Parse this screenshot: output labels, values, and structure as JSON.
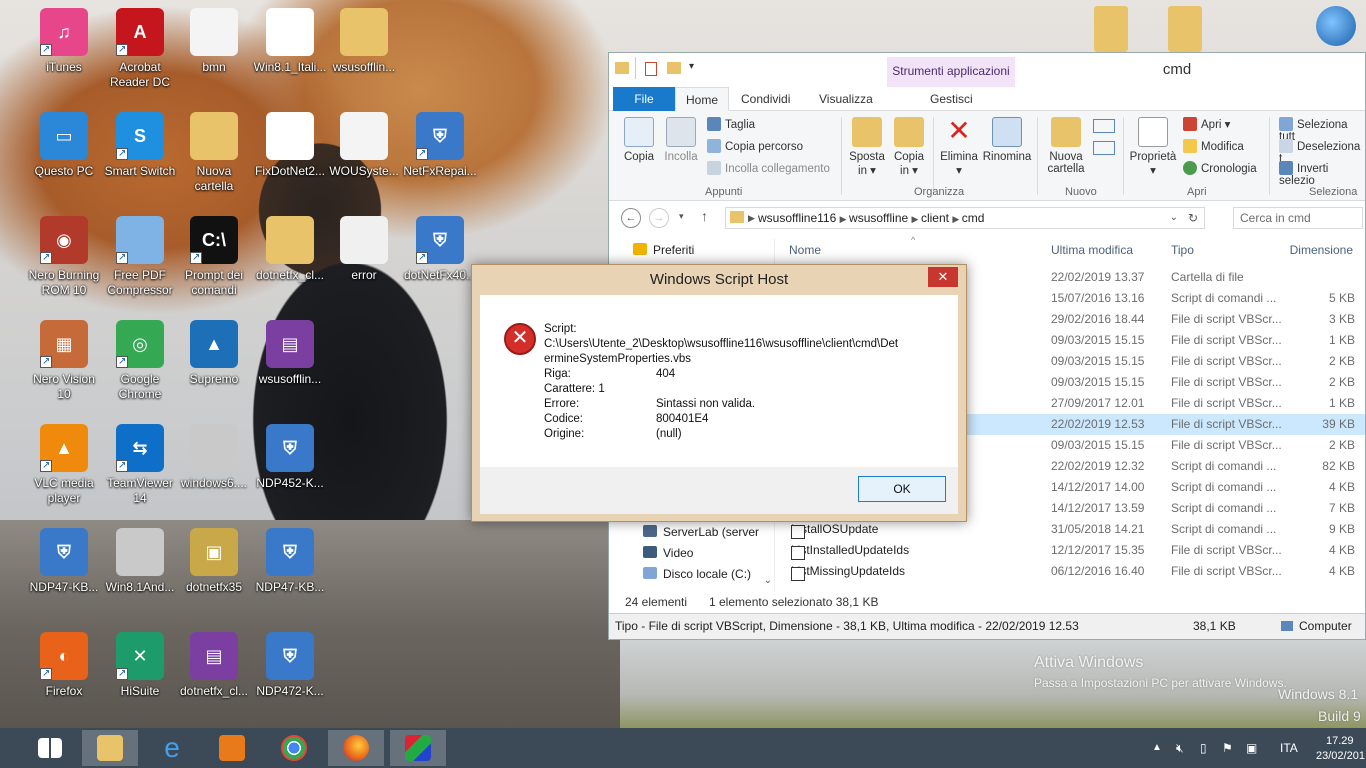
{
  "desktop_icons": [
    {
      "label": "iTunes",
      "color": "#e8468a",
      "glyph": "♫",
      "shortcut": true
    },
    {
      "label": "Acrobat Reader DC",
      "color": "#c4161c",
      "glyph": "A",
      "shortcut": true
    },
    {
      "label": "bmn",
      "color": "#f4f4f4",
      "glyph": "",
      "shortcut": false
    },
    {
      "label": "Win8.1_Itali...",
      "color": "#ffffff",
      "glyph": "",
      "shortcut": false
    },
    {
      "label": "wsusofflin...",
      "color": "#e8c36a",
      "glyph": "",
      "shortcut": false
    },
    {
      "label": "Questo PC",
      "color": "#2b88d8",
      "glyph": "▭",
      "shortcut": false
    },
    {
      "label": "Smart Switch",
      "color": "#1f8fe0",
      "glyph": "S",
      "shortcut": true
    },
    {
      "label": "Nuova cartella",
      "color": "#e8c36a",
      "glyph": "",
      "shortcut": false
    },
    {
      "label": "FixDotNet2...",
      "color": "#ffffff",
      "glyph": "⇨",
      "shortcut": false
    },
    {
      "label": "WOUSyste...",
      "color": "#f4f4f4",
      "glyph": "",
      "shortcut": false
    },
    {
      "label": "NetFxRepai...",
      "color": "#3a78c9",
      "glyph": "⛨",
      "shortcut": true
    },
    {
      "label": "Nero Burning ROM 10",
      "color": "#b23a2a",
      "glyph": "◉",
      "shortcut": true
    },
    {
      "label": "Free PDF Compressor",
      "color": "#7fb3e6",
      "glyph": "",
      "shortcut": true
    },
    {
      "label": "Prompt dei comandi",
      "color": "#111111",
      "glyph": "C:\\",
      "shortcut": true
    },
    {
      "label": "dotnetfx_cl...",
      "color": "#e8c36a",
      "glyph": "",
      "shortcut": false
    },
    {
      "label": "error",
      "color": "#f0f0f0",
      "glyph": "",
      "shortcut": false
    },
    {
      "label": "dotNetFx40...",
      "color": "#3a78c9",
      "glyph": "⛨",
      "shortcut": true
    },
    {
      "label": "Nero Vision 10",
      "color": "#c76a3a",
      "glyph": "▦",
      "shortcut": true
    },
    {
      "label": "Google Chrome",
      "color": "#34a853",
      "glyph": "◎",
      "shortcut": true
    },
    {
      "label": "Supremo",
      "color": "#1d6fb8",
      "glyph": "▲",
      "shortcut": false
    },
    {
      "label": "wsusofflin...",
      "color": "#7a3fa0",
      "glyph": "▤",
      "shortcut": false
    },
    {
      "label": "VLC media player",
      "color": "#f08a0c",
      "glyph": "▲",
      "shortcut": true
    },
    {
      "label": "TeamViewer 14",
      "color": "#0e6fc8",
      "glyph": "⇆",
      "shortcut": true
    },
    {
      "label": "windows6....",
      "color": "#c9c9c9",
      "glyph": "",
      "shortcut": false
    },
    {
      "label": "NDP452-K...",
      "color": "#3a78c9",
      "glyph": "⛨",
      "shortcut": false
    },
    {
      "label": "NDP47-KB...",
      "color": "#3a78c9",
      "glyph": "⛨",
      "shortcut": false
    },
    {
      "label": "Win8.1And...",
      "color": "#c9c9c9",
      "glyph": "",
      "shortcut": false
    },
    {
      "label": "dotnetfx35",
      "color": "#c9a84a",
      "glyph": "▣",
      "shortcut": false
    },
    {
      "label": "NDP47-KB...",
      "color": "#3a78c9",
      "glyph": "⛨",
      "shortcut": false
    },
    {
      "label": "Firefox",
      "color": "#e8621a",
      "glyph": "◐",
      "shortcut": true
    },
    {
      "label": "HiSuite",
      "color": "#1d9b6a",
      "glyph": "✕",
      "shortcut": true
    },
    {
      "label": "dotnetfx_cl...",
      "color": "#7a3fa0",
      "glyph": "▤",
      "shortcut": false
    },
    {
      "label": "NDP472-K...",
      "color": "#3a78c9",
      "glyph": "⛨",
      "shortcut": false
    }
  ],
  "explorer": {
    "window_title": "cmd",
    "contextual_tab": "Strumenti applicazioni",
    "tabs": [
      "File",
      "Home",
      "Condividi",
      "Visualizza",
      "Gestisci"
    ],
    "ribbon": {
      "copy": "Copia",
      "paste": "Incolla",
      "cut": "Taglia",
      "copy_path": "Copia percorso",
      "paste_link": "Incolla collegamento",
      "clipboard_group": "Appunti",
      "move_to": "Sposta in ▾",
      "copy_to": "Copia in ▾",
      "delete": "Elimina ▾",
      "rename": "Rinomina",
      "organize_group": "Organizza",
      "new_folder": "Nuova cartella",
      "new_group": "Nuovo",
      "properties": "Proprietà ▾",
      "open": "Apri ▾",
      "edit": "Modifica",
      "history": "Cronologia",
      "open_group": "Apri",
      "select_all": "Seleziona tutt",
      "select_none": "Deseleziona t",
      "invert": "Inverti selezio",
      "select_group": "Seleziona"
    },
    "breadcrumb": [
      "wsusoffline116",
      "wsusoffline",
      "client",
      "cmd"
    ],
    "search_placeholder": "Cerca in cmd",
    "nav": {
      "favorites": "Preferiti",
      "items": [
        "ServerLab (server",
        "Video",
        "Disco locale (C:)"
      ]
    },
    "columns": {
      "name": "Nome",
      "date": "Ultima modifica",
      "type": "Tipo",
      "size": "Dimensione"
    },
    "rows": [
      {
        "name": "",
        "date": "22/02/2019 13.37",
        "type": "Cartella di file",
        "size": ""
      },
      {
        "name": "",
        "date": "15/07/2016 13.16",
        "type": "Script di comandi ...",
        "size": "5 KB"
      },
      {
        "name": "deAutoLogon",
        "date": "29/02/2016 18.44",
        "type": "File di script VBScr...",
        "size": "3 KB"
      },
      {
        "name": "",
        "date": "09/03/2015 15.15",
        "type": "File di script VBScr...",
        "size": "1 KB"
      },
      {
        "name": "",
        "date": "09/03/2015 15.15",
        "type": "File di script VBScr...",
        "size": "2 KB"
      },
      {
        "name": "",
        "date": "09/03/2015 15.15",
        "type": "File di script VBScr...",
        "size": "2 KB"
      },
      {
        "name": "",
        "date": "27/09/2017 12.01",
        "type": "File di script VBScr...",
        "size": "1 KB"
      },
      {
        "name": "",
        "date": "22/02/2019 12.53",
        "type": "File di script VBScr...",
        "size": "39 KB"
      },
      {
        "name": "",
        "date": "09/03/2015 15.15",
        "type": "File di script VBScr...",
        "size": "2 KB"
      },
      {
        "name": "",
        "date": "22/02/2019 12.32",
        "type": "Script di comandi ...",
        "size": "82 KB"
      },
      {
        "name": "",
        "date": "14/12/2017 14.00",
        "type": "Script di comandi ...",
        "size": "4 KB"
      },
      {
        "name": "",
        "date": "14/12/2017 13.59",
        "type": "Script di comandi ...",
        "size": "7 KB"
      },
      {
        "name": "InstallOSUpdate",
        "date": "31/05/2018 14.21",
        "type": "Script di comandi ...",
        "size": "9 KB"
      },
      {
        "name": "ListInstalledUpdateIds",
        "date": "12/12/2017 15.35",
        "type": "File di script VBScr...",
        "size": "4 KB"
      },
      {
        "name": "ListMissingUpdateIds",
        "date": "06/12/2016 16.40",
        "type": "File di script VBScr...",
        "size": "4 KB"
      }
    ],
    "status_count": "24 elementi",
    "status_selected": "1 elemento selezionato  38,1 KB",
    "details_text": "Tipo - File di script VBScript, Dimensione - 38,1 KB, Ultima modifica - 22/02/2019 12.53",
    "details_size": "38,1 KB",
    "details_location": "Computer"
  },
  "dialog": {
    "title": "Windows Script Host",
    "close": "✕",
    "script_label": "Script:",
    "script_path_1": "C:\\Users\\Utente_2\\Desktop\\wsusoffline116\\wsusoffline\\client\\cmd\\Det",
    "script_path_2": "ermineSystemProperties.vbs",
    "riga_label": "Riga:",
    "riga": "404",
    "carattere": "Carattere:  1",
    "errore_label": "Errore:",
    "errore": "Sintassi non valida.",
    "codice_label": "Codice:",
    "codice": "800401E4",
    "origine_label": "Origine:",
    "origine": "(null)",
    "ok": "OK"
  },
  "watermark": {
    "line1": "Attiva Windows",
    "line2": "Passa a Impostazioni PC per attivare Windows.",
    "edition": "Windows 8.1",
    "build": "Build 9"
  },
  "taskbar": {
    "lang": "ITA",
    "time": "17.29",
    "date": "23/02/201"
  }
}
